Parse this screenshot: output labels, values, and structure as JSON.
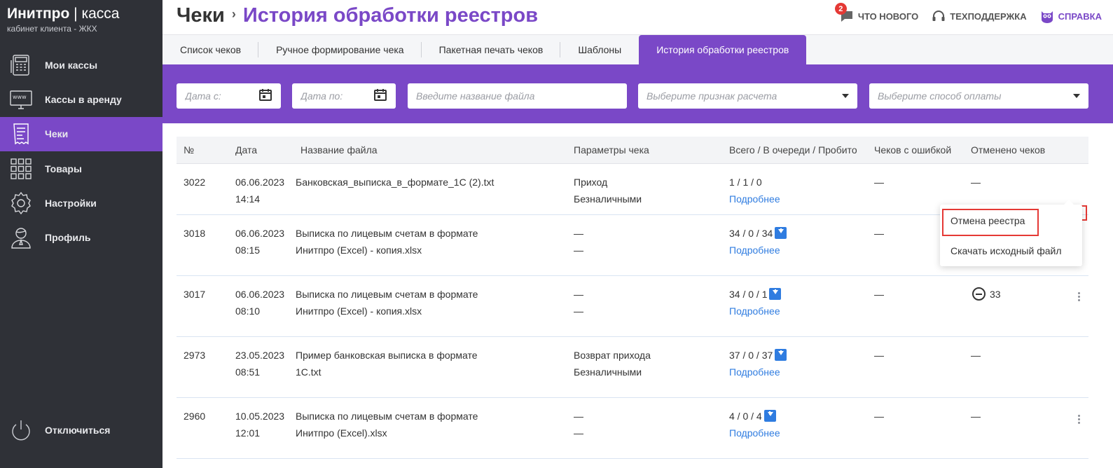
{
  "brand": {
    "name_bold": "Инитпро",
    "divider": "|",
    "name_thin": "касса",
    "subtitle": "кабинет клиента - ЖКХ"
  },
  "sidebar": {
    "items": [
      {
        "label": "Мои кассы",
        "icon": "cash-register-icon"
      },
      {
        "label": "Кассы в аренду",
        "icon": "www-monitor-icon"
      },
      {
        "label": "Чеки",
        "icon": "receipt-icon",
        "active": true
      },
      {
        "label": "Товары",
        "icon": "grid-icon"
      },
      {
        "label": "Настройки",
        "icon": "gear-icon"
      },
      {
        "label": "Профиль",
        "icon": "user-icon"
      }
    ],
    "logout_label": "Отключиться"
  },
  "header": {
    "title": "Чеки",
    "separator": "›",
    "subtitle": "История обработки реестров",
    "links": {
      "whats_new": "ЧТО НОВОГО",
      "whats_new_badge": "2",
      "support": "ТЕХПОДДЕРЖКА",
      "help": "СПРАВКА"
    }
  },
  "tabs": [
    {
      "label": "Список чеков"
    },
    {
      "label": "Ручное формирование чека"
    },
    {
      "label": "Пакетная печать чеков"
    },
    {
      "label": "Шаблоны"
    },
    {
      "label": "История обработки реестров",
      "active": true
    }
  ],
  "filters": {
    "date_from_placeholder": "Дата с:",
    "date_to_placeholder": "Дата по:",
    "filename_placeholder": "Введите название файла",
    "payment_sign_placeholder": "Выберите признак расчета",
    "payment_method_placeholder": "Выберите способ оплаты"
  },
  "table": {
    "headers": [
      "№",
      "Дата",
      "Название файла",
      "Параметры чека",
      "Всего / В очереди / Пробито",
      "Чеков с ошибкой",
      "Отменено чеков"
    ],
    "details_label": "Подробнее",
    "rows": [
      {
        "num": "3022",
        "date": "06.06.2023",
        "time": "14:14",
        "file1": "Банковская_выписка_в_формате_1С (2).txt",
        "file2": "",
        "param1": "Приход",
        "param2": "Безналичными",
        "counts": "1 / 1 / 0",
        "errors": "—",
        "cancelled": "—"
      },
      {
        "num": "3018",
        "date": "06.06.2023",
        "time": "08:15",
        "file1": "Выписка по лицевым счетам в формате",
        "file2": "Инитпро (Excel) - копия.xlsx",
        "param1": "—",
        "param2": "—",
        "counts": "34 / 0 / 34",
        "errors": "—",
        "cancelled": ""
      },
      {
        "num": "3017",
        "date": "06.06.2023",
        "time": "08:10",
        "file1": "Выписка по лицевым счетам в формате",
        "file2": "Инитпро (Excel) - копия.xlsx",
        "param1": "—",
        "param2": "—",
        "counts": "34 / 0 / 1",
        "errors": "—",
        "cancelled": "33"
      },
      {
        "num": "2973",
        "date": "23.05.2023",
        "time": "08:51",
        "file1": "Пример банковская выписка в формате",
        "file2": "1С.txt",
        "param1": "Возврат прихода",
        "param2": "Безналичными",
        "counts": "37 / 0 / 37",
        "errors": "—",
        "cancelled": "—"
      },
      {
        "num": "2960",
        "date": "10.05.2023",
        "time": "12:01",
        "file1": "Выписка по лицевым счетам в формате",
        "file2": "Инитпро (Excel).xlsx",
        "param1": "—",
        "param2": "—",
        "counts": "4 / 0 / 4",
        "errors": "—",
        "cancelled": "—"
      }
    ]
  },
  "context_menu": {
    "cancel_registry": "Отмена реестра",
    "download_source": "Скачать исходный файл"
  },
  "colors": {
    "accent": "#7a48c7",
    "sidebar_bg": "#2f3137",
    "link": "#2f7ce0",
    "highlight": "#e53935"
  }
}
